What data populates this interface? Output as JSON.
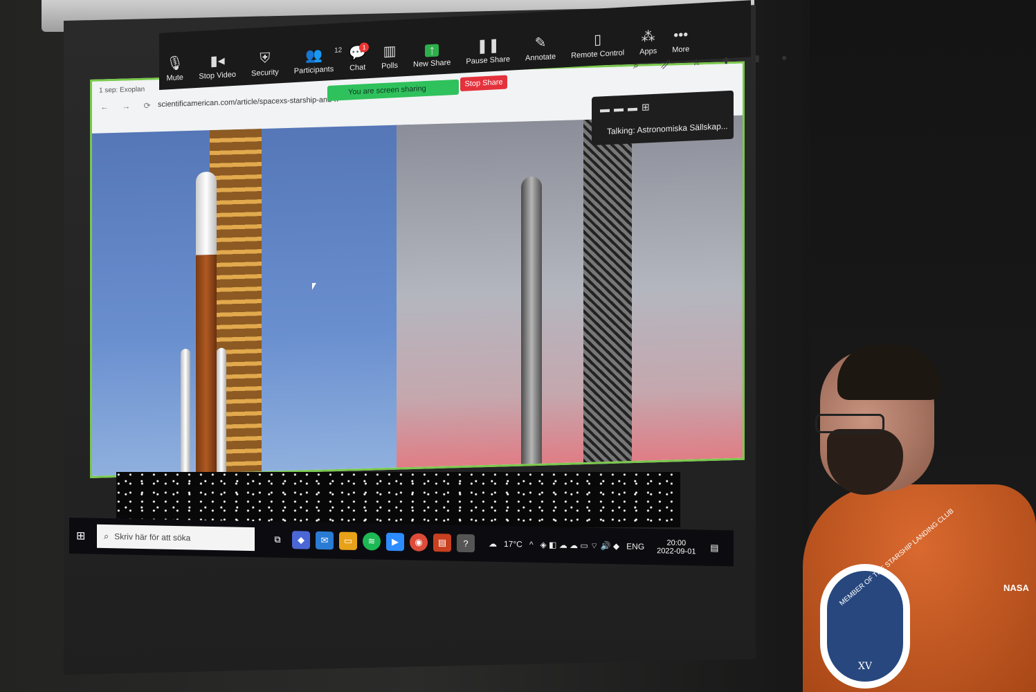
{
  "browser": {
    "tab_label": "1 sep: Exoplan",
    "url": "scientificamerican.com/article/spacexs-starship-and-n"
  },
  "zoom_toolbar": {
    "items": [
      {
        "label": "Mute",
        "icon": "microphone-icon"
      },
      {
        "label": "Stop Video",
        "icon": "video-camera-icon"
      },
      {
        "label": "Security",
        "icon": "shield-icon"
      },
      {
        "label": "Participants",
        "icon": "participants-icon",
        "count": "12"
      },
      {
        "label": "Chat",
        "icon": "chat-icon",
        "badge": "1"
      },
      {
        "label": "Polls",
        "icon": "polls-icon"
      },
      {
        "label": "New Share",
        "icon": "share-up-arrow-icon"
      },
      {
        "label": "Pause Share",
        "icon": "pause-icon"
      },
      {
        "label": "Annotate",
        "icon": "pencil-icon"
      },
      {
        "label": "Remote Control",
        "icon": "mouse-icon"
      },
      {
        "label": "Apps",
        "icon": "apps-icon"
      },
      {
        "label": "More",
        "icon": "more-dots-icon"
      }
    ],
    "sharing_status": "You are screen sharing",
    "stop_share": "Stop Share"
  },
  "talking_panel": {
    "text": "Talking: Astronomiska Sällskap..."
  },
  "taskbar": {
    "search_placeholder": "Skriv här för att söka",
    "weather": "17°C",
    "language": "ENG",
    "time": "20:00",
    "date": "2022-09-01"
  },
  "shirt": {
    "patch_numeral": "XV",
    "patch_ring_text": "MEMBER OF THE STARSHIP LANDING CLUB",
    "brand": "NASA"
  },
  "colors": {
    "share_border": "#79c94b",
    "sharing_pill": "#2fc15c",
    "stop_share": "#e4323c",
    "shirt": "#c85a25"
  }
}
